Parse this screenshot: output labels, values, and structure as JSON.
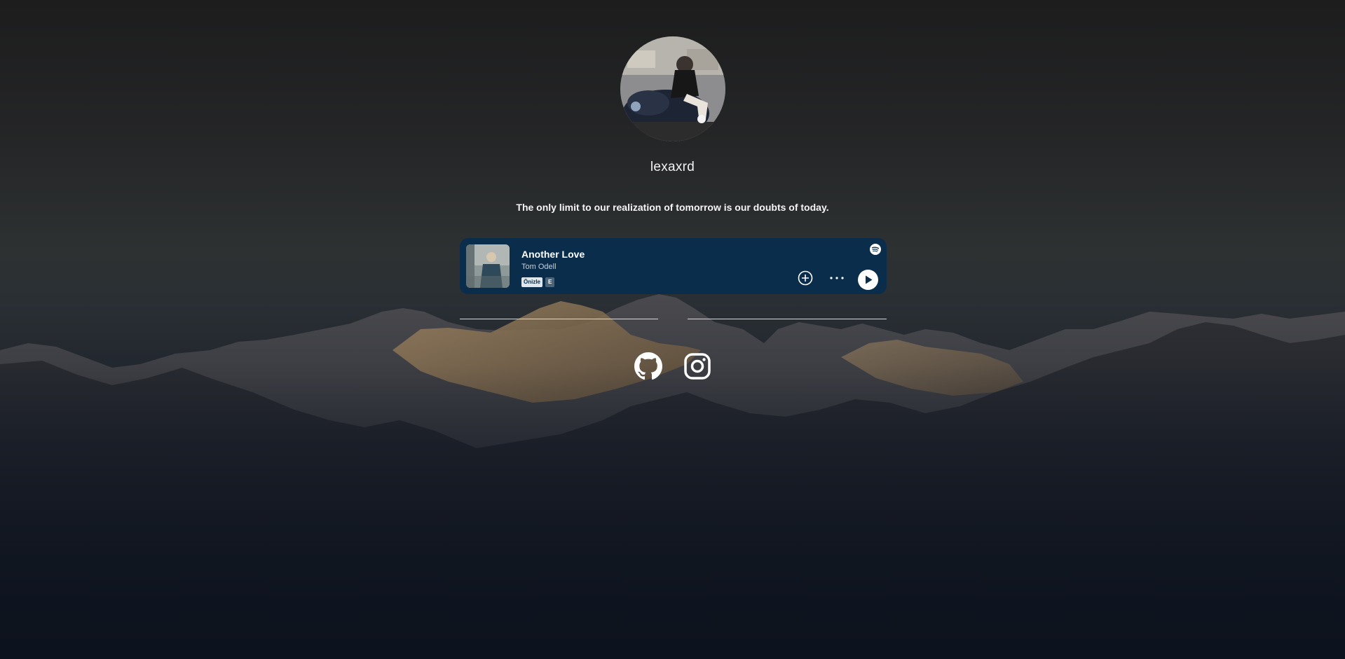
{
  "profile": {
    "username": "lexaxrd",
    "avatar": "profile-photo",
    "quote": "The only limit to our realization of tomorrow is our doubts of today."
  },
  "player": {
    "track_title": "Another Love",
    "artist": "Tom Odell",
    "badge_preview": "Önizle",
    "badge_explicit": "E",
    "cover": "album-cover",
    "brand_icon": "spotify-icon",
    "colors": {
      "background": "#0a2d4c",
      "play_button": "#ffffff"
    }
  },
  "socials": [
    {
      "name": "github",
      "icon": "github-icon"
    },
    {
      "name": "instagram",
      "icon": "instagram-icon"
    }
  ],
  "colors": {
    "background_top": "#1d1d1e",
    "background_bottom": "#0d1420",
    "divider": "#d9d9d9"
  }
}
